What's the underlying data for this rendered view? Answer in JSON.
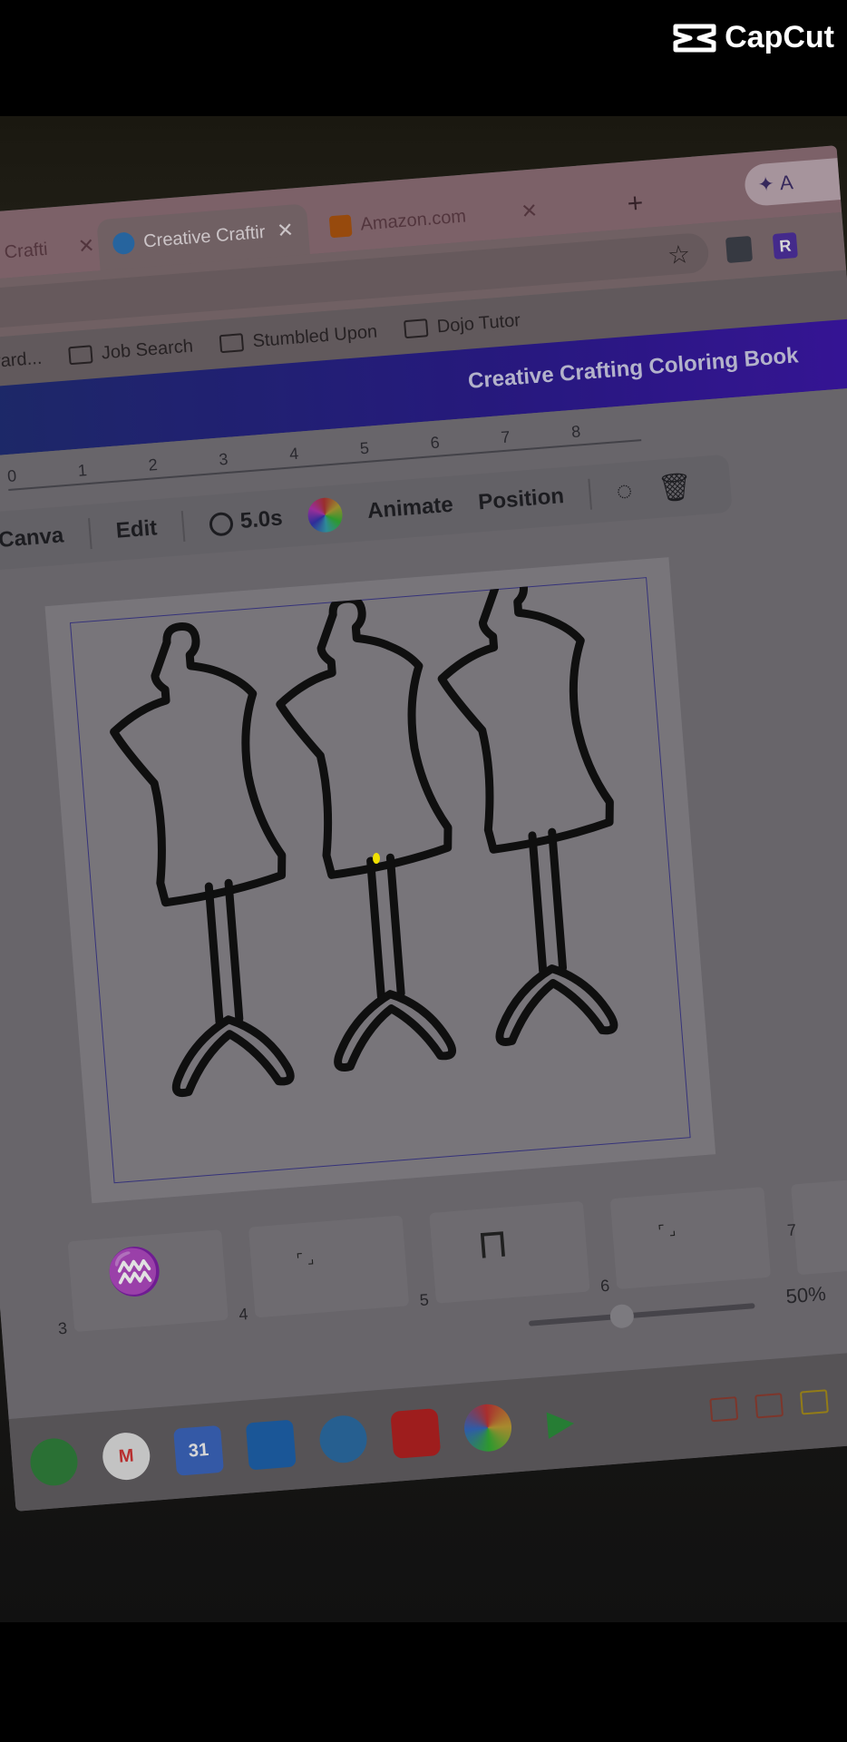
{
  "watermark": {
    "brand": "CapCut"
  },
  "browser": {
    "tabs": [
      {
        "label": "Creative Crafti"
      },
      {
        "label": "Creative Craftir"
      },
      {
        "label": "Amazon.com"
      }
    ],
    "new_tab": "+",
    "spark_label": "A",
    "profile_initial": "R",
    "bookmarks": [
      {
        "label": "e // Toward..."
      },
      {
        "label": "Job Search"
      },
      {
        "label": "Stumbled Upon"
      },
      {
        "label": "Dojo Tutor"
      }
    ]
  },
  "canva": {
    "document_title": "Creative Crafting Coloring Book",
    "ruler_ticks": [
      "0",
      "1",
      "2",
      "3",
      "4",
      "5",
      "6",
      "7",
      "8"
    ],
    "toolbar": {
      "ask": "Ask Canva",
      "edit": "Edit",
      "duration": "5.0s",
      "animate": "Animate",
      "position": "Position"
    },
    "pages": [
      {
        "number": "3"
      },
      {
        "number": "4"
      },
      {
        "number": "5"
      },
      {
        "number": "6"
      },
      {
        "number": "7"
      }
    ],
    "zoom": "50%",
    "zoom_level": 0.4
  },
  "shelf": {
    "calendar_day": "31",
    "locale": "US"
  }
}
